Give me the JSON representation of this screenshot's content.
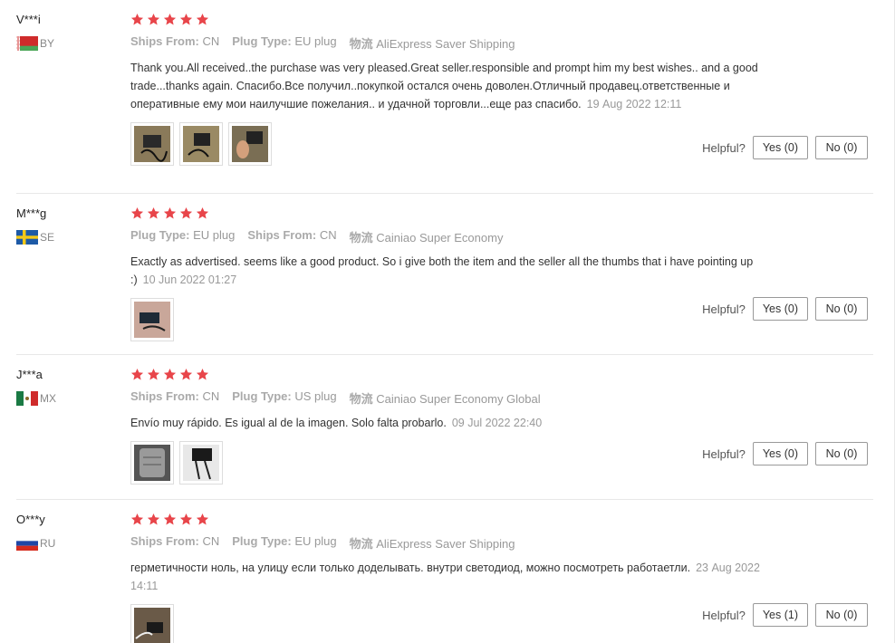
{
  "star_color": "#e8454a",
  "reviews": [
    {
      "user": "V***i",
      "country": "BY",
      "flag": "belarus",
      "meta": [
        {
          "key": "Ships From:",
          "value": "CN"
        },
        {
          "key": "Plug Type:",
          "value": "EU plug"
        },
        {
          "key": "物流",
          "value": "AliExpress Saver Shipping"
        }
      ],
      "text": "Thank you.All received..the purchase was very pleased.Great seller.responsible and prompt him my best wishes.. and a good trade...thanks again. Спасибо.Все получил..покупкой остался очень доволен.Отличный продавец.ответственные и оперативные ему мои наилучшие пожелания.. и удачной торговли...еще раз спасибо.",
      "date": "19 Aug 2022 12:11",
      "helpful_label": "Helpful?",
      "yes": "Yes (0)",
      "no": "No (0)"
    },
    {
      "user": "M***g",
      "country": "SE",
      "flag": "sweden",
      "meta": [
        {
          "key": "Plug Type:",
          "value": "EU plug"
        },
        {
          "key": "Ships From:",
          "value": "CN"
        },
        {
          "key": "物流",
          "value": "Cainiao Super Economy"
        }
      ],
      "text": "Exactly as advertised. seems like a good product. So i give both the item and the seller all the thumbs that i have pointing up :)",
      "date": "10 Jun 2022 01:27",
      "helpful_label": "Helpful?",
      "yes": "Yes (0)",
      "no": "No (0)"
    },
    {
      "user": "J***a",
      "country": "MX",
      "flag": "mexico",
      "meta": [
        {
          "key": "Ships From:",
          "value": "CN"
        },
        {
          "key": "Plug Type:",
          "value": "US plug"
        },
        {
          "key": "物流",
          "value": "Cainiao Super Economy Global"
        }
      ],
      "text": "Envío muy rápido. Es igual al de la imagen. Solo falta probarlo.",
      "date": "09 Jul 2022 22:40",
      "helpful_label": "Helpful?",
      "yes": "Yes (0)",
      "no": "No (0)"
    },
    {
      "user": "O***y",
      "country": "RU",
      "flag": "russia",
      "meta": [
        {
          "key": "Ships From:",
          "value": "CN"
        },
        {
          "key": "Plug Type:",
          "value": "EU plug"
        },
        {
          "key": "物流",
          "value": "AliExpress Saver Shipping"
        }
      ],
      "text": "герметичности ноль, на улицу если только доделывать. внутри светодиод, можно посмотреть работаетли.",
      "date": "23 Aug 2022 14:11",
      "helpful_label": "Helpful?",
      "yes": "Yes (1)",
      "no": "No (0)"
    }
  ]
}
